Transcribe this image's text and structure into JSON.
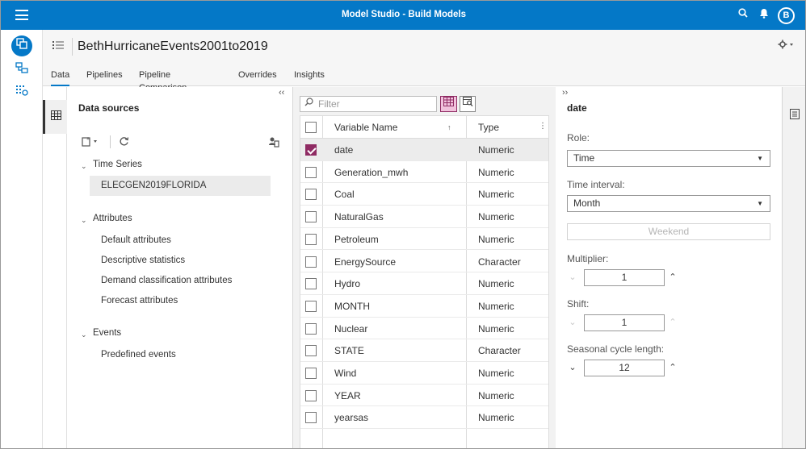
{
  "topbar": {
    "title": "Model Studio - Build Models",
    "avatar_initial": "B",
    "icons": [
      "menu-icon",
      "search-icon",
      "bell-icon"
    ]
  },
  "leftnav": {
    "items": [
      {
        "icon": "build-models-icon",
        "active": true
      },
      {
        "icon": "pipeline-icon",
        "active": false
      },
      {
        "icon": "data-icon",
        "active": false
      }
    ]
  },
  "header": {
    "project_title": "BethHurricaneEvents2001to2019",
    "tabs": [
      {
        "label": "Data",
        "active": true
      },
      {
        "label": "Pipelines",
        "active": false
      },
      {
        "label": "Pipeline Comparison",
        "active": false
      },
      {
        "label": "Overrides",
        "active": false
      },
      {
        "label": "Insights",
        "active": false
      }
    ]
  },
  "datasources": {
    "heading": "Data sources",
    "time_series": {
      "label": "Time Series",
      "items": [
        "ELECGEN2019FLORIDA"
      ]
    },
    "attributes": {
      "label": "Attributes",
      "items": [
        "Default attributes",
        "Descriptive statistics",
        "Demand classification attributes",
        "Forecast attributes"
      ]
    },
    "events": {
      "label": "Events",
      "items": [
        "Predefined events"
      ]
    }
  },
  "grid": {
    "filter_placeholder": "Filter",
    "columns": {
      "name": "Variable Name",
      "type": "Type"
    },
    "rows": [
      {
        "name": "date",
        "type": "Numeric",
        "checked": true
      },
      {
        "name": "Generation_mwh",
        "type": "Numeric",
        "checked": false
      },
      {
        "name": "Coal",
        "type": "Numeric",
        "checked": false
      },
      {
        "name": "NaturalGas",
        "type": "Numeric",
        "checked": false
      },
      {
        "name": "Petroleum",
        "type": "Numeric",
        "checked": false
      },
      {
        "name": "EnergySource",
        "type": "Character",
        "checked": false
      },
      {
        "name": "Hydro",
        "type": "Numeric",
        "checked": false
      },
      {
        "name": "MONTH",
        "type": "Numeric",
        "checked": false
      },
      {
        "name": "Nuclear",
        "type": "Numeric",
        "checked": false
      },
      {
        "name": "STATE",
        "type": "Character",
        "checked": false
      },
      {
        "name": "Wind",
        "type": "Numeric",
        "checked": false
      },
      {
        "name": "YEAR",
        "type": "Numeric",
        "checked": false
      },
      {
        "name": "yearsas",
        "type": "Numeric",
        "checked": false
      }
    ]
  },
  "properties": {
    "heading": "date",
    "role_label": "Role:",
    "role_value": "Time",
    "interval_label": "Time interval:",
    "interval_value": "Month",
    "weekend_button": "Weekend",
    "multiplier_label": "Multiplier:",
    "multiplier_value": "1",
    "shift_label": "Shift:",
    "shift_value": "1",
    "seasonal_label": "Seasonal cycle length:",
    "seasonal_value": "12"
  },
  "colors": {
    "brand_blue": "#0478c7",
    "accent_maroon": "#8f2b63"
  }
}
